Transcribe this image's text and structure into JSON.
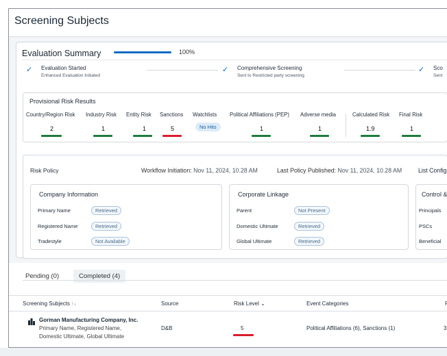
{
  "page": {
    "title": "Screening Subjects"
  },
  "evaluation": {
    "title": "Evaluation Summary",
    "progress_text": "100%",
    "progress_value": 1.0,
    "steps": [
      {
        "title": "Evaluation Started",
        "subtitle": "Enhanced Evaluation Initiated"
      },
      {
        "title": "Comprehensive Screening",
        "subtitle": "Sent to Restricted party screening"
      },
      {
        "title": "Sco",
        "subtitle": "Sent"
      }
    ]
  },
  "risk_results": {
    "title": "Provisional Risk Results",
    "metrics": [
      {
        "label": "Country/Region Risk",
        "value": "2",
        "color": "#1e7a3c"
      },
      {
        "label": "Industry Risk",
        "value": "1",
        "color": "#1e7a3c"
      },
      {
        "label": "Entity Risk",
        "value": "1",
        "color": "#1e7a3c"
      },
      {
        "label": "Sanctions",
        "value": "5",
        "color": "#d81e2c"
      },
      {
        "label": "Watchlists",
        "value": "No Hits",
        "color": ""
      },
      {
        "label": "Political Affiliations (PEP)",
        "value": "1",
        "color": "#1e7a3c"
      },
      {
        "label": "Adverse media",
        "value": "1",
        "color": "#1e7a3c"
      },
      {
        "label": "Calculated Risk",
        "value": "1.9",
        "color": "#1e7a3c"
      },
      {
        "label": "Final Risk",
        "value": "1",
        "color": "#1e7a3c"
      }
    ]
  },
  "policy": {
    "title": "Risk Policy",
    "workflow_label": "Workflow Initiation:",
    "workflow_value": "Nov 11, 2024, 10.28 AM",
    "published_label": "Last Policy Published:",
    "published_value": "Nov 11, 2024, 10.28 AM",
    "list_config": "List Config",
    "company": {
      "title": "Company Information",
      "rows": [
        {
          "label": "Primary Name",
          "status": "Retrieved"
        },
        {
          "label": "Registered Name",
          "status": "Retrieved"
        },
        {
          "label": "Tradestyle",
          "status": "Not Available"
        }
      ]
    },
    "linkage": {
      "title": "Corporate Linkage",
      "rows": [
        {
          "label": "Parent",
          "status": "Not Present"
        },
        {
          "label": "Domestic Ultimate",
          "status": "Retrieved"
        },
        {
          "label": "Global Ultimate",
          "status": "Retrieved"
        }
      ]
    },
    "control": {
      "title": "Control &",
      "rows": [
        {
          "label": "Principals"
        },
        {
          "label": "PSCs"
        },
        {
          "label": "Beneficial"
        }
      ]
    }
  },
  "tabs": [
    {
      "label": "Pending (0)"
    },
    {
      "label": "Completed (4)"
    }
  ],
  "table": {
    "headers": {
      "subjects": "Screening Subjects",
      "sort_icon": "↑↓",
      "source": "Source",
      "risk": "Risk Level",
      "risk_icon": "⌄",
      "events": "Event Categories",
      "last": "R"
    },
    "rows": [
      {
        "name": "Gorman Manufacturing Company, Inc.",
        "details_line1": "Primary Name, Registered Name,",
        "details_line2": "Domestic Ultimate, Global Ultimate",
        "source": "D&B",
        "risk": "5",
        "risk_color": "#d81e2c",
        "events": "Political Affiliations (6),  Sanctions (1)",
        "last": "3"
      }
    ]
  }
}
